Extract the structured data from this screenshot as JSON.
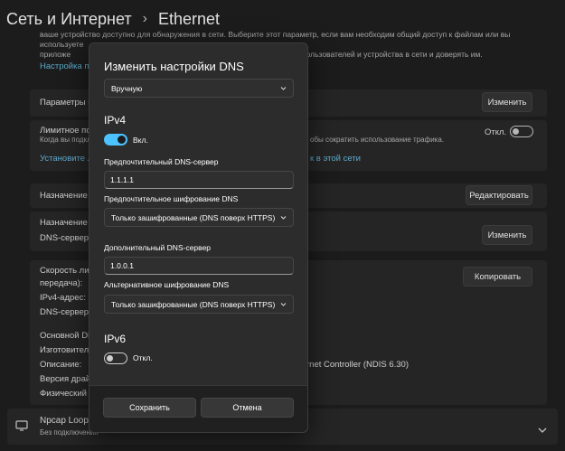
{
  "breadcrumb": {
    "parent": "Сеть и Интернет",
    "separator": "›",
    "current": "Ethernet"
  },
  "background": {
    "top_description_line1": "ваше устройство доступно для обнаружения в сети. Выберите этот параметр, если вам необходим общий доступ к файлам или вы используете",
    "top_description_line2": "приложе",
    "top_description_line2_end": "пользователей и устройства в сети и доверять им.",
    "network_link": "Настройка па",
    "params_label": "Параметры п",
    "change_button_1": "Изменить",
    "metered_label": "Лимитное по",
    "metered_sub": "Когда вы подкл",
    "metered_sub_end": "обы сократить использование трафика.",
    "metered_state": "Откл.",
    "limit_link": "Установите ли",
    "limit_link_end": "к в этой сети",
    "assignment_ip_label": "Назначение I",
    "edit_button": "Редактировать",
    "assignment_dns_label": "Назначение D",
    "dns_servers_label": "DNS-серверы",
    "change_button_2": "Изменить",
    "speed_label": "Скорость лин",
    "speed_label_2": "передача):",
    "ipv4_label": "IPv4-адрес:",
    "dns_label_2": "DNS-серверы",
    "copy_button": "Копировать",
    "main_dns_label": "Основной DN",
    "manufacturer_label": "Изготовитель",
    "description_label": "Описание:",
    "description_value_end": "rnet Controller (NDIS 6.30)",
    "driver_label": "Версия драйв",
    "physical_label": "Физический а",
    "npcap_title": "Npcap Loopba",
    "npcap_sub": "Без подключения"
  },
  "dialog": {
    "title": "Изменить настройки DNS",
    "mode_select": "Вручную",
    "ipv4": {
      "heading": "IPv4",
      "toggle_state": "Вкл.",
      "preferred_label": "Предпочтительный DNS-сервер",
      "preferred_value": "1.1.1.1",
      "preferred_enc_label": "Предпочтительное шифрование DNS",
      "preferred_enc_value": "Только зашифрованные (DNS поверх HTTPS)",
      "alternate_label": "Дополнительный DNS-сервер",
      "alternate_value": "1.0.0.1",
      "alternate_enc_label": "Альтернативное шифрование DNS",
      "alternate_enc_value": "Только зашифрованные (DNS поверх HTTPS)"
    },
    "ipv6": {
      "heading": "IPv6",
      "toggle_state": "Откл."
    },
    "save_button": "Сохранить",
    "cancel_button": "Отмена"
  },
  "colors": {
    "accent": "#4cc2ff",
    "link": "#6cc1e8",
    "dialog_bg": "#2c2c2c",
    "page_bg": "#202020"
  }
}
